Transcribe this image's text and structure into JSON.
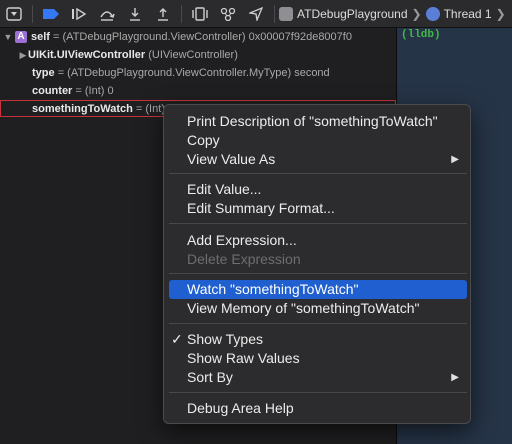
{
  "toolbar": {
    "breadcrumb_app": "ATDebugPlayground",
    "breadcrumb_thread": "Thread 1"
  },
  "console": {
    "prompt": "(lldb)"
  },
  "variables": [
    {
      "name": "self",
      "detail": "= (ATDebugPlayground.ViewController) 0x00007f92de8007f0",
      "badge": "A"
    },
    {
      "name": "UIKit.UIViewController",
      "detail": "(UIViewController)"
    },
    {
      "name": "type",
      "detail": "= (ATDebugPlayground.ViewController.MyType) second"
    },
    {
      "name": "counter",
      "detail": "= (Int) 0"
    },
    {
      "name": "somethingToWatch",
      "detail": "= (Int) 0"
    }
  ],
  "context_menu": {
    "items": [
      {
        "label": "Print Description of \"somethingToWatch\""
      },
      {
        "label": "Copy"
      },
      {
        "label": "View Value As"
      },
      {
        "label": "Edit Value..."
      },
      {
        "label": "Edit Summary Format..."
      },
      {
        "label": "Add Expression..."
      },
      {
        "label": "Delete Expression"
      },
      {
        "label": "Watch \"somethingToWatch\""
      },
      {
        "label": "View Memory of \"somethingToWatch\""
      },
      {
        "label": "Show Types"
      },
      {
        "label": "Show Raw Values"
      },
      {
        "label": "Sort By"
      },
      {
        "label": "Debug Area Help"
      }
    ]
  }
}
